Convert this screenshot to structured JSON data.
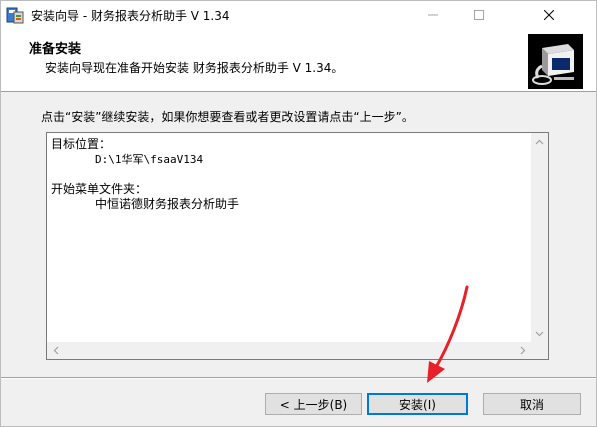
{
  "window": {
    "title": "安装向导 - 财务报表分析助手 V 1.34"
  },
  "header": {
    "title": "准备安装",
    "subtitle": "安装向导现在准备开始安装 财务报表分析助手 V 1.34。"
  },
  "body": {
    "instruction": "点击“安装”继续安装，如果你想要查看或者更改设置请点击“上一步”。",
    "memo": {
      "lines": [
        "目标位置：",
        "D:\\1华军\\fsaaV134",
        "",
        "开始菜单文件夹：",
        "中恒诺德财务报表分析助手"
      ]
    }
  },
  "footer": {
    "back_label": "< 上一步(B)",
    "install_label": "安装(I)",
    "cancel_label": "取消"
  },
  "colors": {
    "accent": "#0078d7",
    "annotation_arrow": "#e8202a"
  },
  "icons": {
    "app": "installer-app-icon",
    "logo": "computer-install-icon"
  }
}
